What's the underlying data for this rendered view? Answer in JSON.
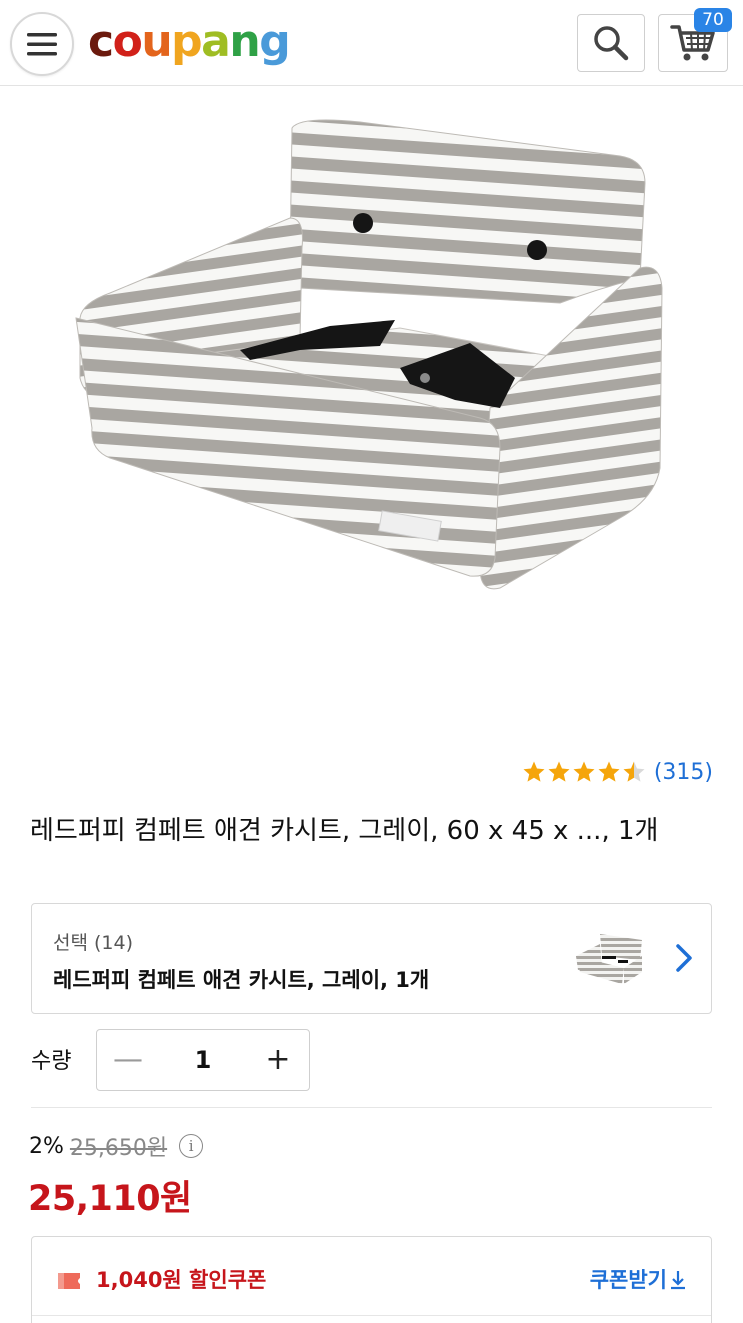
{
  "header": {
    "logo_letters": [
      {
        "ch": "c",
        "color": "#6b1a0e"
      },
      {
        "ch": "o",
        "color": "#d1211a"
      },
      {
        "ch": "u",
        "color": "#e3641c"
      },
      {
        "ch": "p",
        "color": "#f0a51f"
      },
      {
        "ch": "a",
        "color": "#9fbd23"
      },
      {
        "ch": "n",
        "color": "#2fa146"
      },
      {
        "ch": "g",
        "color": "#4a9ad9"
      }
    ],
    "menu_icon": "hamburger-icon",
    "search_icon": "search-icon",
    "cart_icon": "cart-icon",
    "cart_count": "70"
  },
  "rating": {
    "stars": 4.5,
    "count": "(315)",
    "star_color": "#f5a50b"
  },
  "product": {
    "title": "레드퍼피 컴페트 애견 카시트, 그레이, 60 x 45 x ..., 1개"
  },
  "option": {
    "label": "선택 (14)",
    "value": "레드퍼피 컴페트 애견 카시트, 그레이, 1개"
  },
  "quantity": {
    "label": "수량",
    "minus": "—",
    "value": "1",
    "plus": "+"
  },
  "price": {
    "discount_rate": "2%",
    "original": "25,650원",
    "sale": "25,110원",
    "info_icon": "i"
  },
  "coupon": {
    "text": "1,040원 할인쿠폰",
    "action": "쿠폰받기"
  },
  "colors": {
    "accent_red": "#c6151b",
    "link_blue": "#1e6fd6",
    "badge_blue": "#2a84e6"
  }
}
